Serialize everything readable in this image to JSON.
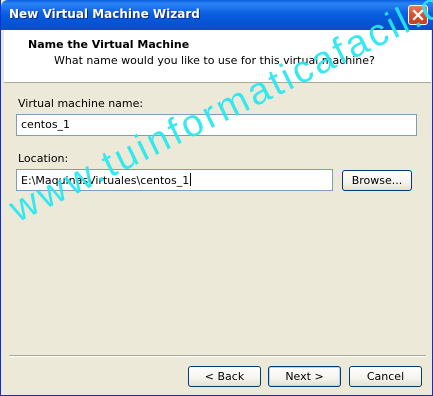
{
  "window": {
    "title": "New Virtual Machine Wizard"
  },
  "header": {
    "title": "Name the Virtual Machine",
    "subtitle": "What name would you like to use for this virtual machine?"
  },
  "form": {
    "name_label": "Virtual machine name:",
    "name_value": "centos_1",
    "location_label": "Location:",
    "location_value": "E:\\MaquinasVirtuales\\centos_1",
    "browse_label": "Browse..."
  },
  "footer": {
    "back_label": "< Back",
    "next_label": "Next >",
    "cancel_label": "Cancel"
  },
  "watermark": {
    "text": "www.tuinformaticafacil.com"
  },
  "colors": {
    "titlebar": "#0a5ddf",
    "window_face": "#ece9d8",
    "watermark": "#26e8f0"
  },
  "icons": {
    "close": "close-icon"
  }
}
